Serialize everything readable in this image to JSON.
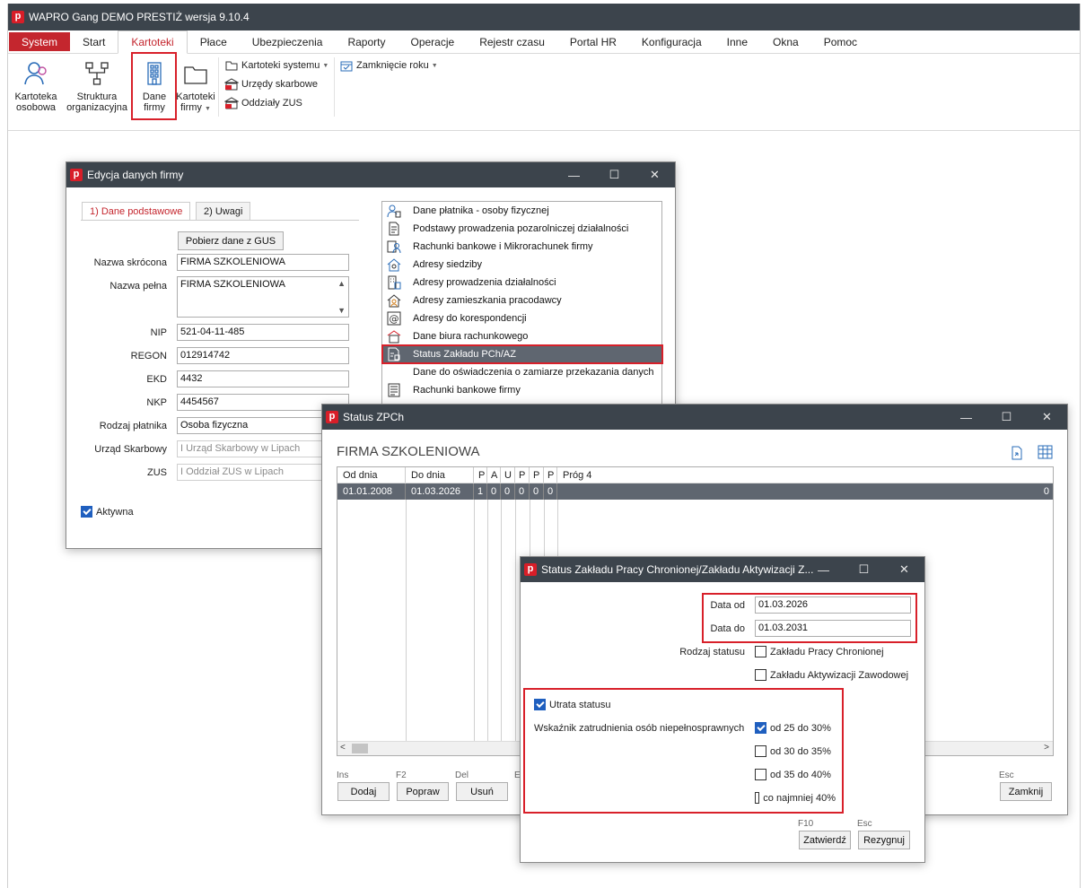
{
  "app": {
    "title": "WAPRO Gang DEMO PRESTIŻ wersja 9.10.4",
    "logo_letter": "p"
  },
  "menu": [
    "System",
    "Start",
    "Kartoteki",
    "Płace",
    "Ubezpieczenia",
    "Raporty",
    "Operacje",
    "Rejestr czasu",
    "Portal HR",
    "Konfiguracja",
    "Inne",
    "Okna",
    "Pomoc"
  ],
  "ribbon": {
    "kartoteka_osobowa": [
      "Kartoteka",
      "osobowa"
    ],
    "struktura": [
      "Struktura",
      "organizacyjna"
    ],
    "dane_firmy": [
      "Dane",
      "firmy"
    ],
    "kartoteki_firmy": [
      "Kartoteki",
      "firmy"
    ],
    "kartoteki_systemu": "Kartoteki systemu",
    "urzedy_skarbowe": "Urzędy skarbowe",
    "oddzialy_zus": "Oddziały ZUS",
    "zamkniecie_roku": "Zamknięcie roku"
  },
  "win_firma": {
    "title": "Edycja danych firmy",
    "tabs": [
      "1) Dane podstawowe",
      "2) Uwagi"
    ],
    "gus_button": "Pobierz dane z GUS",
    "fields": {
      "nazwa_skrocona_label": "Nazwa skrócona",
      "nazwa_skrocona": "FIRMA SZKOLENIOWA",
      "nazwa_pelna_label": "Nazwa pełna",
      "nazwa_pelna": "FIRMA SZKOLENIOWA",
      "nip_label": "NIP",
      "nip": "521-04-11-485",
      "regon_label": "REGON",
      "regon": "012914742",
      "ekd_label": "EKD",
      "ekd": "4432",
      "nkp_label": "NKP",
      "nkp": "4454567",
      "rodzaj_label": "Rodzaj płatnika",
      "rodzaj": "Osoba fizyczna",
      "urzad_label": "Urząd Skarbowy",
      "urzad": "I Urząd Skarbowy w Lipach",
      "zus_label": "ZUS",
      "zus": "I Oddział ZUS w Lipach"
    },
    "aktywna_label": "Aktywna",
    "aktywna_checked": true,
    "list": [
      {
        "label": "Dane płatnika - osoby fizycznej",
        "icon": "person-doc-icon"
      },
      {
        "label": "Podstawy prowadzenia pozarolniczej działalności",
        "icon": "document-icon"
      },
      {
        "label": "Rachunki bankowe i Mikrorachunek firmy",
        "icon": "bank-person-icon"
      },
      {
        "label": "Adresy siedziby",
        "icon": "house-icon"
      },
      {
        "label": "Adresy prowadzenia działalności",
        "icon": "building-doc-icon"
      },
      {
        "label": "Adresy zamieszkania pracodawcy",
        "icon": "home-person-icon"
      },
      {
        "label": "Adresy do korespondencji",
        "icon": "at-sign-icon"
      },
      {
        "label": "Dane biura rachunkowego",
        "icon": "office-icon"
      },
      {
        "label": "Status Zakładu PCh/AZ",
        "icon": "status-icon"
      },
      {
        "label": "Dane do oświadczenia o zamiarze przekazania danych",
        "icon": "blank-icon"
      },
      {
        "label": "Rachunki bankowe firmy",
        "icon": "ledger-icon"
      }
    ]
  },
  "win_zpch": {
    "title": "Status ZPCh",
    "heading": "FIRMA SZKOLENIOWA",
    "columns": [
      "Od dnia",
      "Do dnia",
      "P",
      "A",
      "U",
      "P",
      "P",
      "P",
      "Próg 4"
    ],
    "row": [
      "01.01.2008",
      "01.03.2026",
      "1",
      "0",
      "0",
      "0",
      "0",
      "0",
      "",
      "0"
    ],
    "buttons": [
      {
        "key": "Ins",
        "label": "Dodaj"
      },
      {
        "key": "F2",
        "label": "Popraw"
      },
      {
        "key": "Del",
        "label": "Usuń"
      },
      {
        "key": "E",
        "label": ""
      },
      {
        "key": "Esc",
        "label": "Zamknij"
      }
    ]
  },
  "win_status": {
    "title": "Status Zakładu Pracy Chronionej/Zakładu Aktywizacji Z...",
    "data_od_label": "Data od",
    "data_od": "01.03.2026",
    "data_do_label": "Data do",
    "data_do": "01.03.2031",
    "rodzaj_label": "Rodzaj statusu",
    "rodzaj_options": [
      {
        "label": "Zakładu Pracy Chronionej",
        "checked": false
      },
      {
        "label": "Zakładu Aktywizacji Zawodowej",
        "checked": false
      }
    ],
    "utrata_label": "Utrata statusu",
    "utrata_checked": true,
    "wskaznik_label": "Wskaźnik zatrudnienia osób niepełnosprawnych",
    "wskaznik_options": [
      {
        "label": "od 25 do 30%",
        "checked": true
      },
      {
        "label": "od 30 do 35%",
        "checked": false
      },
      {
        "label": "od 35 do 40%",
        "checked": false
      },
      {
        "label": "co najmniej 40%",
        "checked": false
      }
    ],
    "buttons": [
      {
        "key": "F10",
        "label": "Zatwierdź"
      },
      {
        "key": "Esc",
        "label": "Rezygnuj"
      }
    ]
  }
}
